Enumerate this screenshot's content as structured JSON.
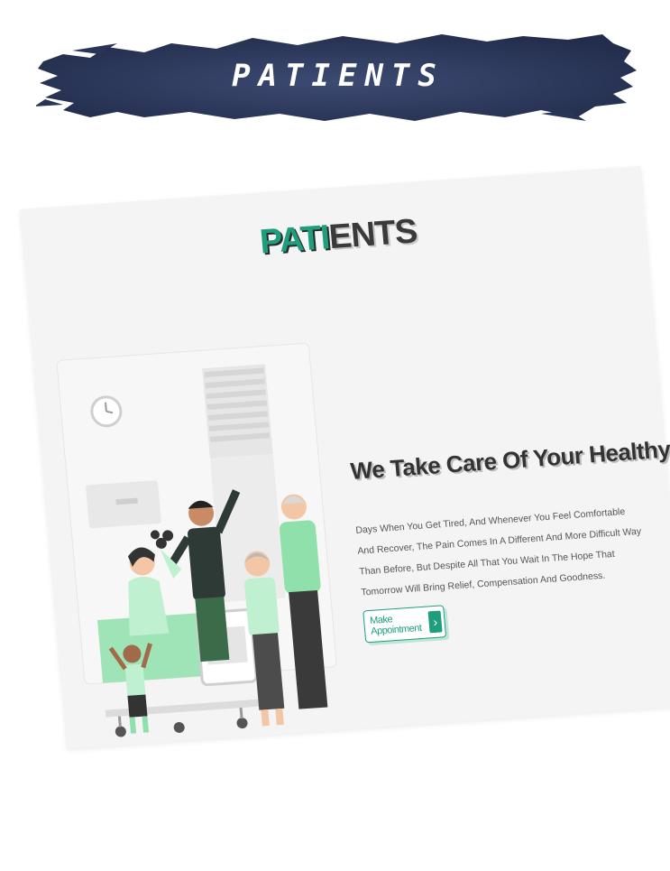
{
  "banner": {
    "title": "PATIENTS",
    "color": "#283556"
  },
  "page": {
    "brand_accent": "PATI",
    "brand_rest": "ENTS",
    "hero_title": "We Take Care Of Your Healthy Life",
    "hero_text": "Days When You Get Tired, And Whenever You Feel Comfortable And Recover, The Pain Comes In A Different And More Difficult Way Than Before, But Despite All That You Wait In The Hope That Tomorrow Will Bring Relief, Compensation And Goodness.",
    "cta_label": "Make Appointment",
    "accent_color": "#1f9e7e",
    "icons": [
      "chevron-right-icon",
      "clock-icon",
      "window-blind-icon",
      "hospital-bed-icon",
      "family-illustration"
    ]
  }
}
